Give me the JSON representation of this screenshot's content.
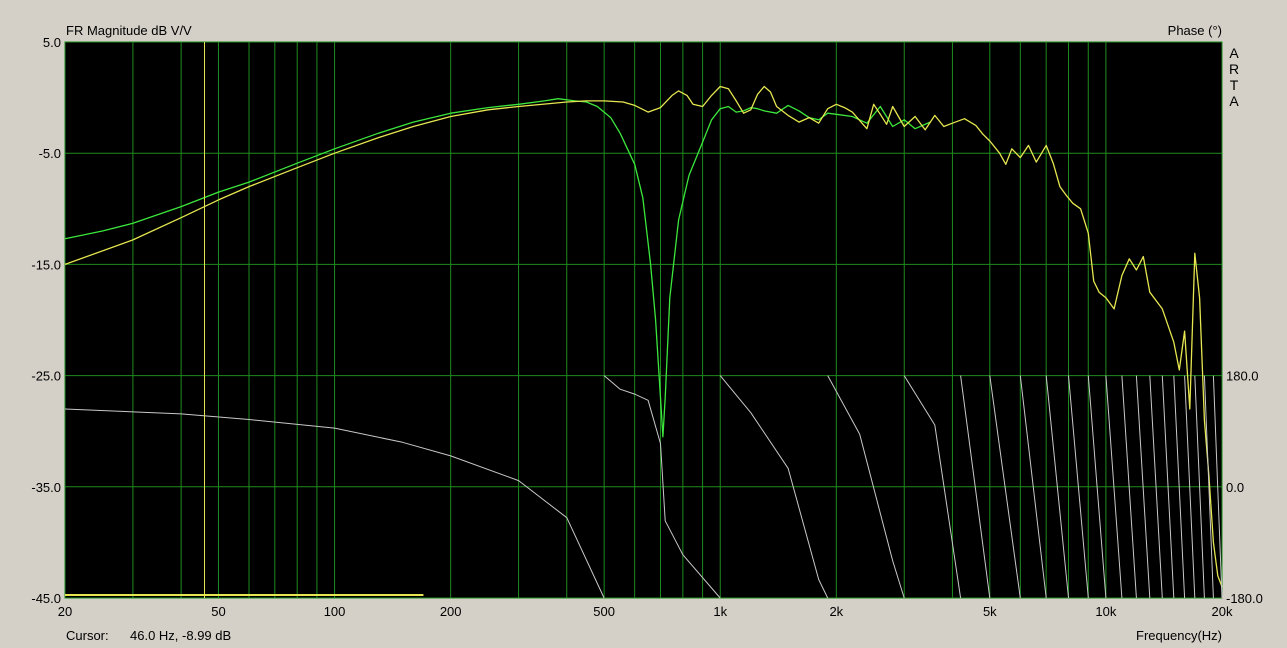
{
  "header": {
    "left_title": "FR Magnitude dB V/V",
    "right_title": "Phase (°)",
    "watermark": "ARTA"
  },
  "footer": {
    "cursor_label": "Cursor:",
    "cursor_value": "46.0 Hz, -8.99 dB",
    "x_axis_title": "Frequency(Hz)"
  },
  "colors": {
    "background": "#d4d0c8",
    "plot": "#000000",
    "grid": "#1e8c1e",
    "trace_green": "#3ce63c",
    "trace_yellow": "#e6e650",
    "phase_trace": "#c8c8c8",
    "cursor": "#e6e650"
  },
  "chart_data": {
    "type": "line",
    "title": "",
    "xlabel": "Frequency(Hz)",
    "ylabel": "FR Magnitude dB V/V",
    "y2label": "Phase (°)",
    "x_scale": "log",
    "xlim": [
      20,
      20000
    ],
    "ylim": [
      -45,
      5
    ],
    "y2lim": [
      -180,
      180
    ],
    "grid": true,
    "x_ticks": [
      {
        "value": 20,
        "label": "20"
      },
      {
        "value": 50,
        "label": "50"
      },
      {
        "value": 100,
        "label": "100"
      },
      {
        "value": 200,
        "label": "200"
      },
      {
        "value": 500,
        "label": "500"
      },
      {
        "value": 1000,
        "label": "1k"
      },
      {
        "value": 2000,
        "label": "2k"
      },
      {
        "value": 5000,
        "label": "5k"
      },
      {
        "value": 10000,
        "label": "10k"
      },
      {
        "value": 20000,
        "label": "20k"
      }
    ],
    "y_ticks": [
      {
        "value": 5,
        "label": "5.0"
      },
      {
        "value": -5,
        "label": "-5.0"
      },
      {
        "value": -15,
        "label": "-15.0"
      },
      {
        "value": -25,
        "label": "-25.0"
      },
      {
        "value": -35,
        "label": "-35.0"
      },
      {
        "value": -45,
        "label": "-45.0"
      }
    ],
    "y2_ticks": [
      {
        "value": 180,
        "label": "180.0"
      },
      {
        "value": 0,
        "label": "0.0"
      },
      {
        "value": -180,
        "label": "-180.0"
      }
    ],
    "cursor": {
      "x": 46,
      "y": -8.99
    },
    "series": [
      {
        "color": "#3ce63c",
        "points": [
          [
            20,
            -12.7
          ],
          [
            25,
            -12.0
          ],
          [
            30,
            -11.3
          ],
          [
            40,
            -9.8
          ],
          [
            50,
            -8.5
          ],
          [
            60,
            -7.6
          ],
          [
            80,
            -5.9
          ],
          [
            100,
            -4.6
          ],
          [
            130,
            -3.2
          ],
          [
            160,
            -2.2
          ],
          [
            200,
            -1.4
          ],
          [
            250,
            -0.9
          ],
          [
            300,
            -0.6
          ],
          [
            350,
            -0.3
          ],
          [
            380,
            -0.1
          ],
          [
            420,
            -0.3
          ],
          [
            450,
            -0.4
          ],
          [
            480,
            -0.8
          ],
          [
            520,
            -1.8
          ],
          [
            550,
            -3.2
          ],
          [
            600,
            -6.0
          ],
          [
            630,
            -9.0
          ],
          [
            660,
            -15.0
          ],
          [
            680,
            -20.0
          ],
          [
            700,
            -27.0
          ],
          [
            710,
            -30.5
          ],
          [
            720,
            -27.0
          ],
          [
            740,
            -18.0
          ],
          [
            780,
            -11.0
          ],
          [
            830,
            -7.0
          ],
          [
            900,
            -4.0
          ],
          [
            950,
            -2.0
          ],
          [
            1000,
            -1.0
          ],
          [
            1050,
            -0.8
          ],
          [
            1100,
            -1.3
          ],
          [
            1150,
            -1.2
          ],
          [
            1200,
            -0.9
          ],
          [
            1250,
            -1.0
          ],
          [
            1300,
            -1.2
          ],
          [
            1400,
            -1.4
          ],
          [
            1500,
            -0.7
          ],
          [
            1600,
            -1.2
          ],
          [
            1700,
            -1.8
          ],
          [
            1800,
            -2.0
          ],
          [
            1900,
            -1.4
          ],
          [
            2000,
            -1.5
          ],
          [
            2200,
            -1.7
          ],
          [
            2400,
            -2.3
          ],
          [
            2600,
            -0.8
          ],
          [
            2800,
            -2.6
          ],
          [
            3000,
            -2.0
          ],
          [
            3200,
            -2.8
          ],
          [
            3500,
            -2.2
          ]
        ]
      },
      {
        "color": "#e6e650",
        "points": [
          [
            20,
            -15.0
          ],
          [
            30,
            -12.8
          ],
          [
            40,
            -10.8
          ],
          [
            50,
            -9.2
          ],
          [
            60,
            -8.0
          ],
          [
            80,
            -6.3
          ],
          [
            100,
            -5.0
          ],
          [
            130,
            -3.6
          ],
          [
            160,
            -2.6
          ],
          [
            200,
            -1.7
          ],
          [
            250,
            -1.1
          ],
          [
            300,
            -0.8
          ],
          [
            400,
            -0.4
          ],
          [
            450,
            -0.3
          ],
          [
            500,
            -0.3
          ],
          [
            560,
            -0.4
          ],
          [
            600,
            -0.7
          ],
          [
            650,
            -1.3
          ],
          [
            700,
            -0.9
          ],
          [
            750,
            0.2
          ],
          [
            780,
            0.6
          ],
          [
            820,
            0.2
          ],
          [
            850,
            -0.6
          ],
          [
            900,
            -0.8
          ],
          [
            950,
            0.2
          ],
          [
            1000,
            1.0
          ],
          [
            1050,
            0.8
          ],
          [
            1100,
            -0.3
          ],
          [
            1150,
            -1.4
          ],
          [
            1200,
            -1.1
          ],
          [
            1250,
            0.3
          ],
          [
            1300,
            1.0
          ],
          [
            1350,
            0.5
          ],
          [
            1400,
            -0.8
          ],
          [
            1500,
            -1.6
          ],
          [
            1600,
            -2.2
          ],
          [
            1700,
            -1.8
          ],
          [
            1800,
            -2.3
          ],
          [
            1900,
            -1.0
          ],
          [
            2000,
            -0.6
          ],
          [
            2100,
            -0.9
          ],
          [
            2200,
            -1.3
          ],
          [
            2400,
            -2.8
          ],
          [
            2500,
            -0.6
          ],
          [
            2600,
            -1.5
          ],
          [
            2700,
            -2.4
          ],
          [
            2800,
            -0.8
          ],
          [
            3000,
            -2.6
          ],
          [
            3200,
            -1.7
          ],
          [
            3400,
            -2.9
          ],
          [
            3600,
            -1.6
          ],
          [
            3800,
            -2.6
          ],
          [
            4000,
            -2.3
          ],
          [
            4300,
            -1.9
          ],
          [
            4600,
            -2.5
          ],
          [
            4800,
            -3.3
          ],
          [
            5000,
            -3.9
          ],
          [
            5300,
            -5.0
          ],
          [
            5500,
            -6.0
          ],
          [
            5700,
            -4.6
          ],
          [
            6000,
            -5.4
          ],
          [
            6300,
            -4.3
          ],
          [
            6600,
            -5.8
          ],
          [
            7000,
            -4.3
          ],
          [
            7300,
            -5.9
          ],
          [
            7600,
            -8.0
          ],
          [
            7900,
            -8.8
          ],
          [
            8200,
            -9.5
          ],
          [
            8600,
            -10.0
          ],
          [
            9000,
            -12.2
          ],
          [
            9300,
            -16.5
          ],
          [
            9600,
            -17.5
          ],
          [
            10000,
            -18.0
          ],
          [
            10500,
            -19.0
          ],
          [
            11000,
            -16.0
          ],
          [
            11500,
            -14.5
          ],
          [
            12000,
            -15.5
          ],
          [
            12500,
            -14.3
          ],
          [
            13000,
            -17.5
          ],
          [
            14000,
            -19.0
          ],
          [
            15000,
            -22.0
          ],
          [
            15500,
            -24.5
          ],
          [
            16000,
            -21.0
          ],
          [
            16500,
            -28.0
          ],
          [
            17000,
            -14.0
          ],
          [
            17500,
            -18.0
          ],
          [
            18000,
            -29.0
          ],
          [
            18500,
            -34.0
          ],
          [
            19000,
            -40.0
          ],
          [
            19500,
            -43.0
          ],
          [
            20000,
            -44.0
          ]
        ]
      },
      {
        "color": "#c8c8c8",
        "axis": "phase",
        "points": [
          [
            20,
            126
          ],
          [
            40,
            118
          ],
          [
            60,
            109
          ],
          [
            100,
            95
          ],
          [
            150,
            72
          ],
          [
            200,
            50
          ],
          [
            300,
            10
          ],
          [
            400,
            -50
          ],
          [
            500,
            -180
          ],
          [
            500,
            180
          ],
          [
            550,
            158
          ],
          [
            600,
            150
          ],
          [
            650,
            140
          ],
          [
            700,
            70
          ],
          [
            720,
            -55
          ],
          [
            800,
            -110
          ],
          [
            1000,
            -180
          ],
          [
            1000,
            180
          ],
          [
            1200,
            120
          ],
          [
            1500,
            30
          ],
          [
            1800,
            -150
          ],
          [
            1900,
            -180
          ],
          [
            1900,
            180
          ],
          [
            2300,
            85
          ],
          [
            2800,
            -120
          ],
          [
            3000,
            -180
          ],
          [
            3000,
            180
          ],
          [
            3600,
            100
          ],
          [
            4200,
            -180
          ],
          [
            4200,
            180
          ],
          [
            5000,
            -180
          ],
          [
            5000,
            180
          ],
          [
            6000,
            -180
          ],
          [
            6000,
            180
          ],
          [
            7000,
            -180
          ],
          [
            7000,
            180
          ],
          [
            8000,
            -180
          ],
          [
            8000,
            180
          ],
          [
            9000,
            -180
          ],
          [
            9000,
            180
          ],
          [
            10000,
            -180
          ],
          [
            10000,
            180
          ],
          [
            11000,
            -180
          ],
          [
            11000,
            180
          ],
          [
            12000,
            -180
          ],
          [
            12000,
            180
          ],
          [
            13000,
            -180
          ],
          [
            13000,
            180
          ],
          [
            14000,
            -180
          ],
          [
            14000,
            180
          ],
          [
            15000,
            -180
          ],
          [
            15000,
            180
          ],
          [
            16000,
            -180
          ],
          [
            16000,
            180
          ],
          [
            17000,
            -180
          ],
          [
            17000,
            180
          ],
          [
            18000,
            -180
          ],
          [
            18000,
            180
          ],
          [
            19000,
            -180
          ],
          [
            19000,
            180
          ],
          [
            20000,
            -180
          ]
        ]
      }
    ]
  }
}
